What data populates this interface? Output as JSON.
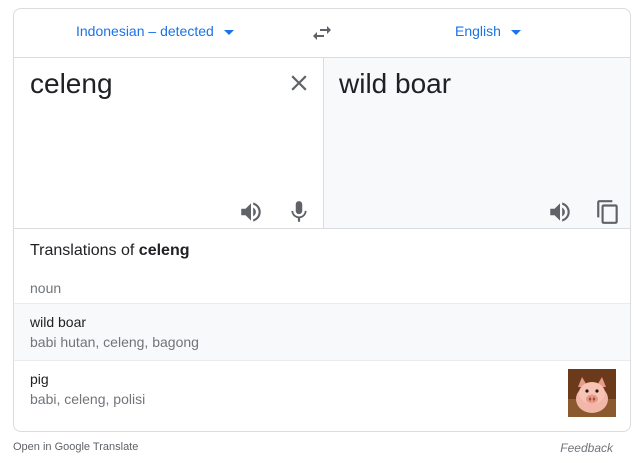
{
  "header": {
    "source_language": "Indonesian – detected",
    "target_language": "English"
  },
  "source": {
    "text": "celeng"
  },
  "target": {
    "text": "wild boar"
  },
  "dictionary": {
    "heading_prefix": "Translations of ",
    "heading_word": "celeng",
    "part_of_speech": "noun",
    "entries": [
      {
        "word": "wild boar",
        "synonyms": "babi hutan, celeng, bagong"
      },
      {
        "word": "pig",
        "synonyms": "babi, celeng, polisi"
      }
    ]
  },
  "footer": {
    "open_link": "Open in Google Translate",
    "feedback": "Feedback"
  },
  "icons": {
    "swap": "swap-arrows-icon",
    "clear": "close-icon",
    "speaker": "speaker-icon",
    "mic": "microphone-icon",
    "copy": "copy-icon"
  },
  "colors": {
    "accent": "#1a73e8",
    "icon": "#5f6368",
    "target_bg": "#f8f9fa"
  }
}
